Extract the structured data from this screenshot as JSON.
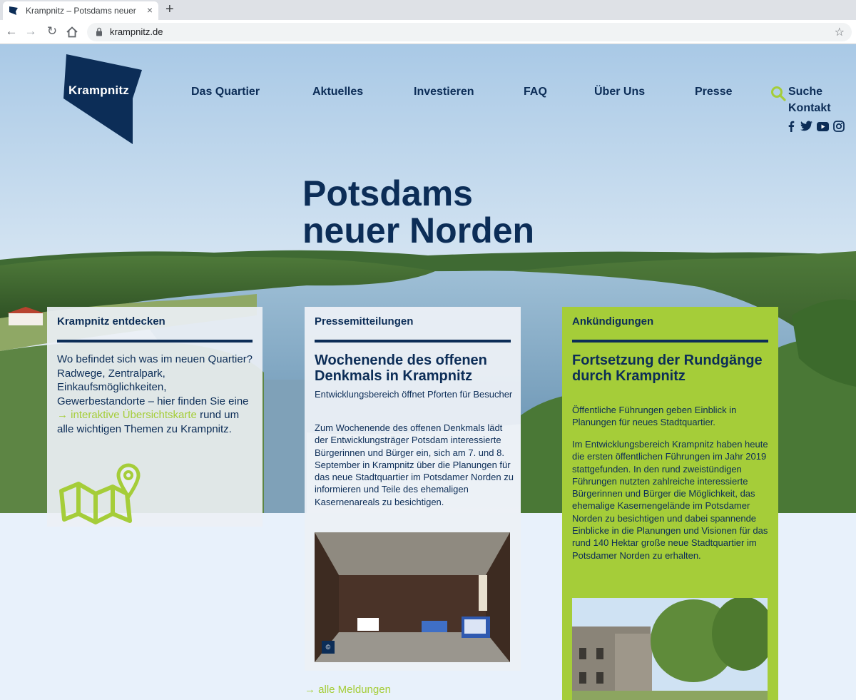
{
  "browser": {
    "tab_title": "Krampnitz – Potsdams neuer Norden",
    "tab_close": "×",
    "new_tab": "+",
    "back": "←",
    "forward": "→",
    "reload": "↻",
    "url": "krampnitz.de",
    "bookmark": "☆"
  },
  "header": {
    "logo_text": "Krampnitz",
    "nav": [
      "Das Quartier",
      "Aktuelles",
      "Investieren",
      "FAQ",
      "Über Uns",
      "Presse"
    ],
    "search_label": "Suche",
    "contact_label": "Kontakt",
    "social": [
      "facebook-icon",
      "twitter-icon",
      "youtube-icon",
      "instagram-icon"
    ]
  },
  "hero": {
    "title_line1": "Potsdams",
    "title_line2": "neuer Norden"
  },
  "cards": [
    {
      "heading": "Krampnitz entdecken",
      "body_before_link": "Wo befindet sich was im neuen Quartier? Radwege, Zentralpark, Einkaufsmöglichkeiten, Gewerbestandorte – hier finden Sie eine ",
      "link_text": "→ interaktive Übersichtskarte",
      "body_after_link": " rund um alle wichtigen Themen zu Krampnitz."
    },
    {
      "heading": "Pressemitteilungen",
      "title": "Wochenende des offenen Denkmals in Krampnitz",
      "subtitle": "Entwicklungsbereich öffnet Pforten für Besucher",
      "body": "Zum Wochenende des offenen Denkmals lädt der Entwicklungsträger Potsdam interessierte Bürgerinnen und Bürger ein, sich am 7. und 8. September in Krampnitz über die Planungen für das neue Stadtquartier im Potsdamer Norden zu informieren und Teile des ehemaligen Kasernenareals zu besichtigen.",
      "copyright": "©"
    },
    {
      "heading": "Ankündigungen",
      "title": "Fortsetzung der Rundgänge durch Krampnitz",
      "subtitle": "Öffentliche Führungen geben Einblick in Planungen für neues Stadtquartier.",
      "body": "Im Entwicklungsbereich Krampnitz haben heute die ersten öffentlichen Führungen im Jahr 2019 stattgefunden. In den rund zweistündigen Führungen nutzten zahlreiche interessierte Bürgerinnen und Bürger die Möglichkeit, das ehemalige Kasernengelände im Potsdamer Norden zu besichtigen und dabei spannende Einblicke in die Planungen und Visionen für das rund 140 Hektar große neue Stadtquartier im Potsdamer Norden zu erhalten."
    }
  ],
  "more_link": "→ alle Meldungen",
  "colors": {
    "navy": "#0c2d57",
    "green": "#a5cd39",
    "page_bg": "#e8f1fb"
  }
}
